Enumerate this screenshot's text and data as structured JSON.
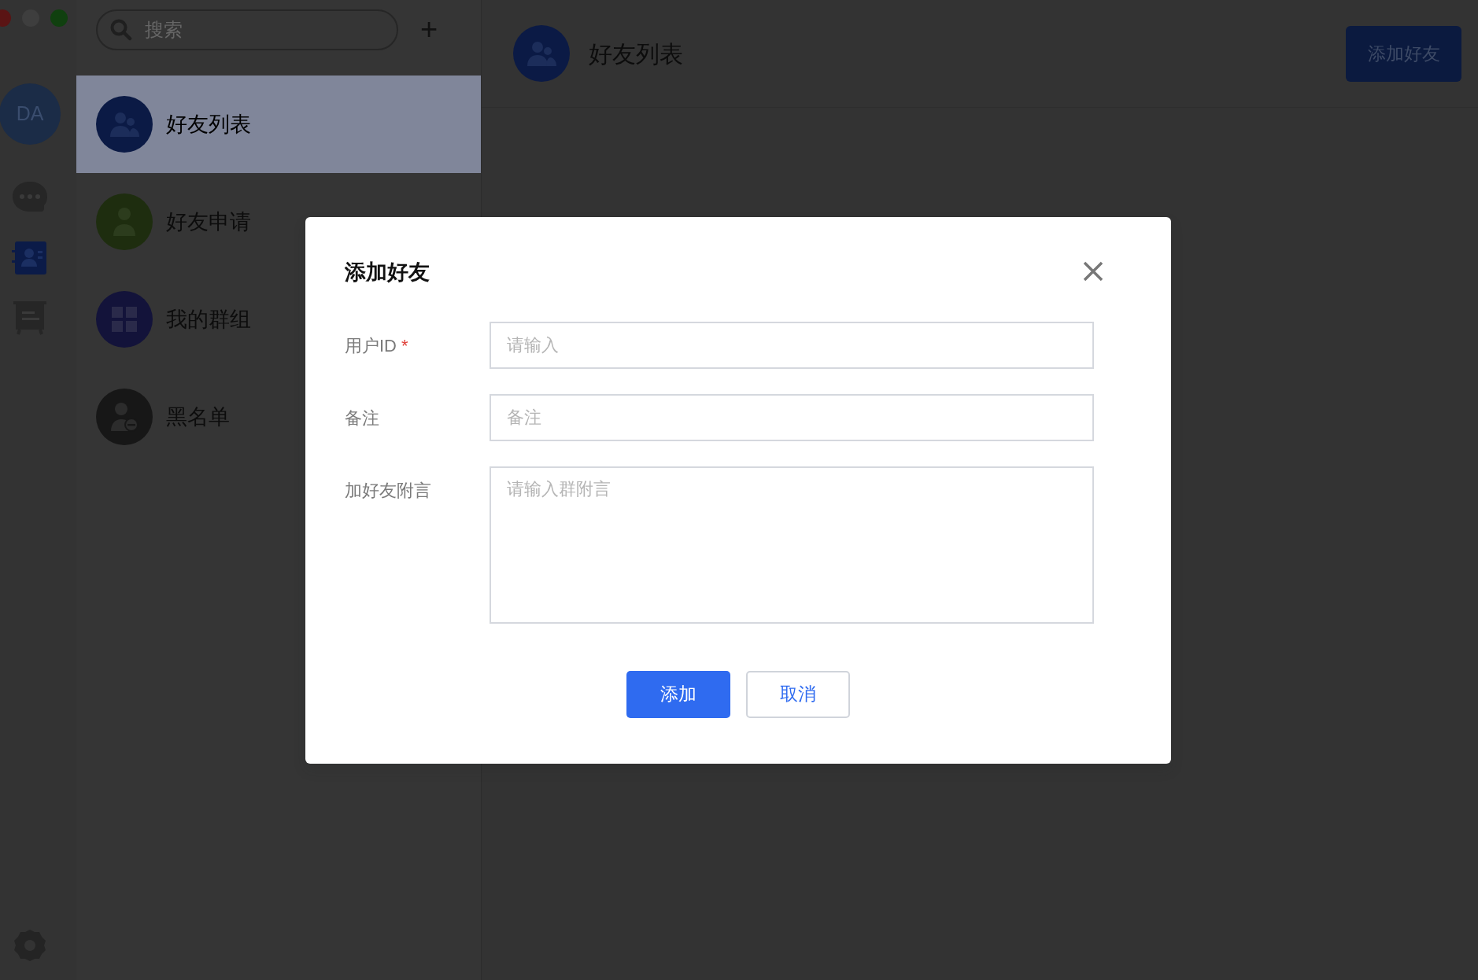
{
  "rail": {
    "avatar": "DA",
    "items": [
      {
        "kind": "chat",
        "selected": false
      },
      {
        "kind": "contacts",
        "selected": true
      },
      {
        "kind": "board",
        "selected": false
      }
    ]
  },
  "search": {
    "placeholder": "搜索"
  },
  "add_symbol": "+",
  "list": [
    {
      "label": "好友列表",
      "kind": "friends",
      "color": "#0b1a45",
      "selected": true
    },
    {
      "label": "好友申请",
      "kind": "person",
      "color": "#1e2d0f",
      "selected": false
    },
    {
      "label": "我的群组",
      "kind": "grid",
      "color": "#13133a",
      "selected": false
    },
    {
      "label": "黑名单",
      "kind": "blocked",
      "color": "#171717",
      "selected": false
    }
  ],
  "header": {
    "title": "好友列表",
    "button": "添加好友"
  },
  "dialog": {
    "title": "添加好友",
    "required_mark": "*",
    "fields": [
      {
        "label": "用户ID",
        "required": true,
        "kind": "input",
        "placeholder": "请输入"
      },
      {
        "label": "备注",
        "required": false,
        "kind": "input",
        "placeholder": "备注"
      },
      {
        "label": "加好友附言",
        "required": false,
        "kind": "textarea",
        "placeholder": "请输入群附言"
      }
    ],
    "buttons": [
      {
        "label": "添加",
        "kind": "primary"
      },
      {
        "label": "取消",
        "kind": "secondary"
      }
    ]
  }
}
